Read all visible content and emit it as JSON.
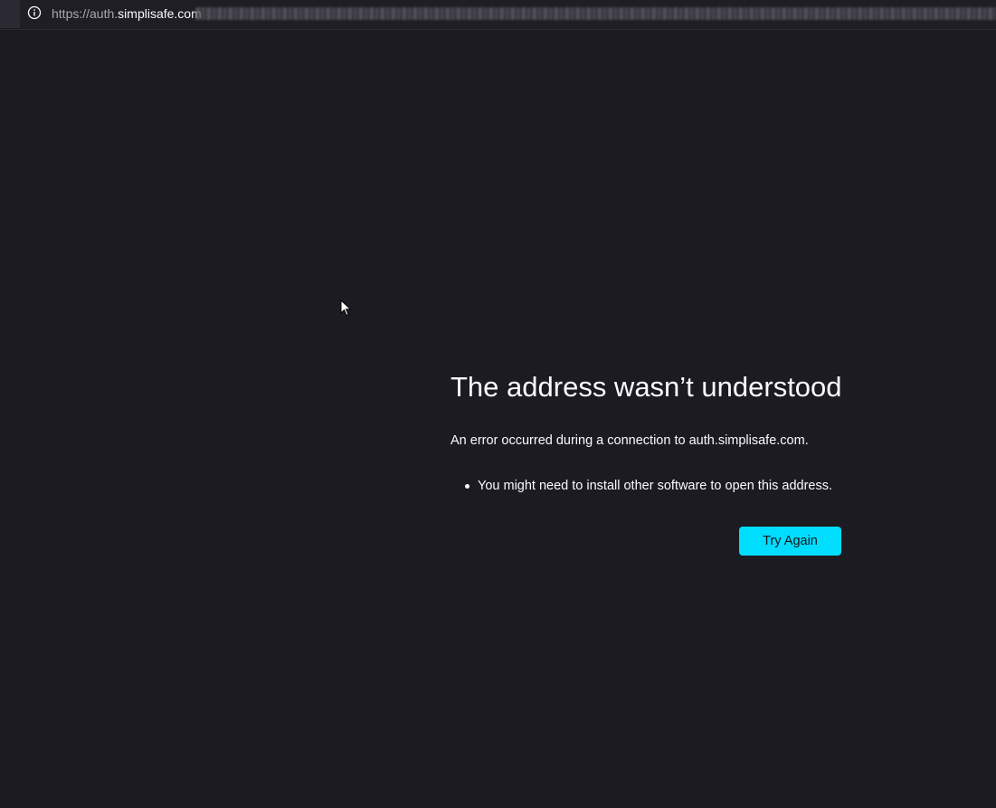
{
  "browser": {
    "url_scheme": "https://auth.",
    "url_host": "simplisafe.com",
    "info_icon": "info-icon"
  },
  "error_page": {
    "title": "The address wasn’t understood",
    "description": "An error occurred during a connection to auth.simplisafe.com.",
    "bullets": [
      "You might need to install other software to open this address."
    ],
    "try_again_label": "Try Again"
  },
  "colors": {
    "background": "#1c1b22",
    "text": "#fbfbfe",
    "accent_button": "#00ddff"
  }
}
